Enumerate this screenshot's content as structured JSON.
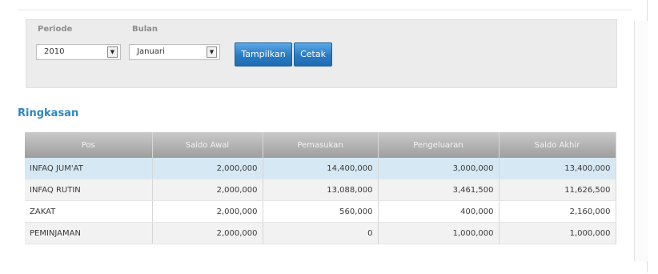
{
  "filter": {
    "periode": {
      "label": "Periode",
      "value": "2010"
    },
    "bulan": {
      "label": "Bulan",
      "value": "Januari"
    },
    "tampilkan_label": "Tampilkan",
    "cetak_label": "Cetak"
  },
  "section_title": "Ringkasan",
  "table": {
    "headers": [
      "Pos",
      "Saldo Awal",
      "Pemasukan",
      "Pengeluaran",
      "Saldo Akhir"
    ],
    "rows": [
      [
        "INFAQ JUM'AT",
        "2,000,000",
        "14,400,000",
        "3,000,000",
        "13,400,000"
      ],
      [
        "INFAQ RUTIN",
        "2,000,000",
        "13,088,000",
        "3,461,500",
        "11,626,500"
      ],
      [
        "ZAKAT",
        "2,000,000",
        "560,000",
        "400,000",
        "2,160,000"
      ],
      [
        "PEMINJAMAN",
        "2,000,000",
        "0",
        "1,000,000",
        "1,000,000"
      ]
    ]
  }
}
